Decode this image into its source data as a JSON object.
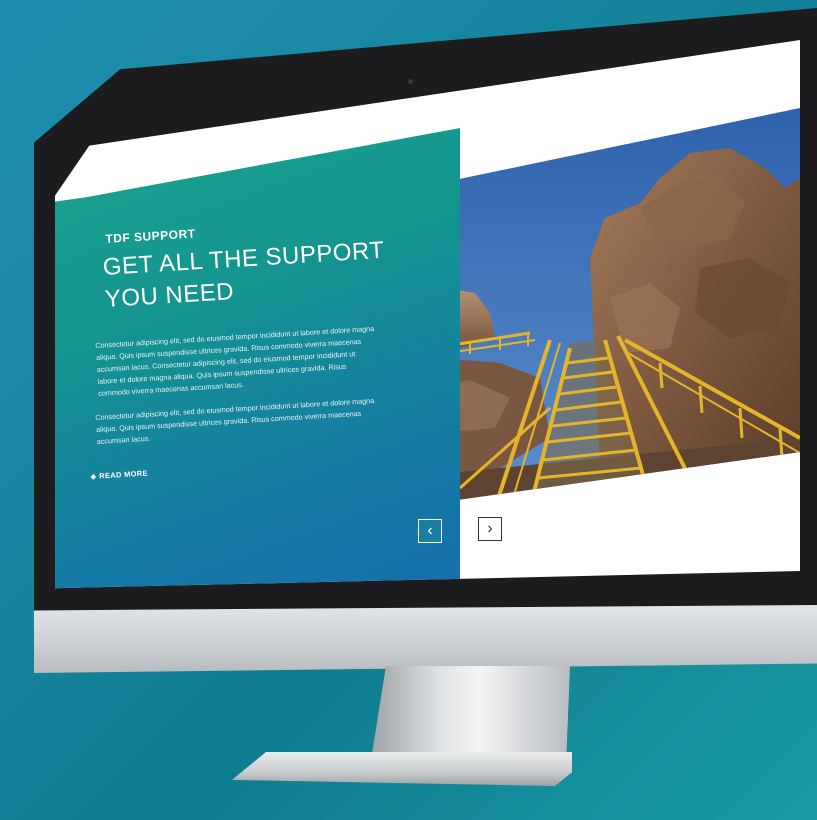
{
  "website": {
    "eyebrow": "TDF SUPPORT",
    "headline": "GET ALL THE SUPPORT YOU NEED",
    "paragraph_1": "Consectetur adipiscing elit, sed do eiusmod tempor incididunt ut labore et dolore magna aliqua. Quis ipsum suspendisse ultrices gravida. Risus commodo viverra maecenas accumsan lacus. Consectetur adipiscing elit, sed do eiusmod tempor incididunt ut labore et dolore magna aliqua. Quis ipsum suspendisse ultrices gravida. Risus commodo viverra maecenas accumsan lacus.",
    "paragraph_2": "Consectetur adipiscing elit, sed do eiusmod tempor incididunt ut labore et dolore magna aliqua. Quis ipsum suspendisse ultrices gravida. Risus commodo viverra maecenas accumsan lacus.",
    "read_more": "READ MORE",
    "prev_icon": "‹",
    "next_icon": "›",
    "icons": {
      "prev": "chevron-left-icon",
      "next": "chevron-right-icon",
      "read_more": "diamond-bullet-icon"
    }
  },
  "colors": {
    "panel_gradient_start": "#1aa58f",
    "panel_gradient_end": "#1670ad",
    "background": "#1a8ea8",
    "stair_yellow": "#e4b52a",
    "sky_blue": "#3b6fb6"
  }
}
